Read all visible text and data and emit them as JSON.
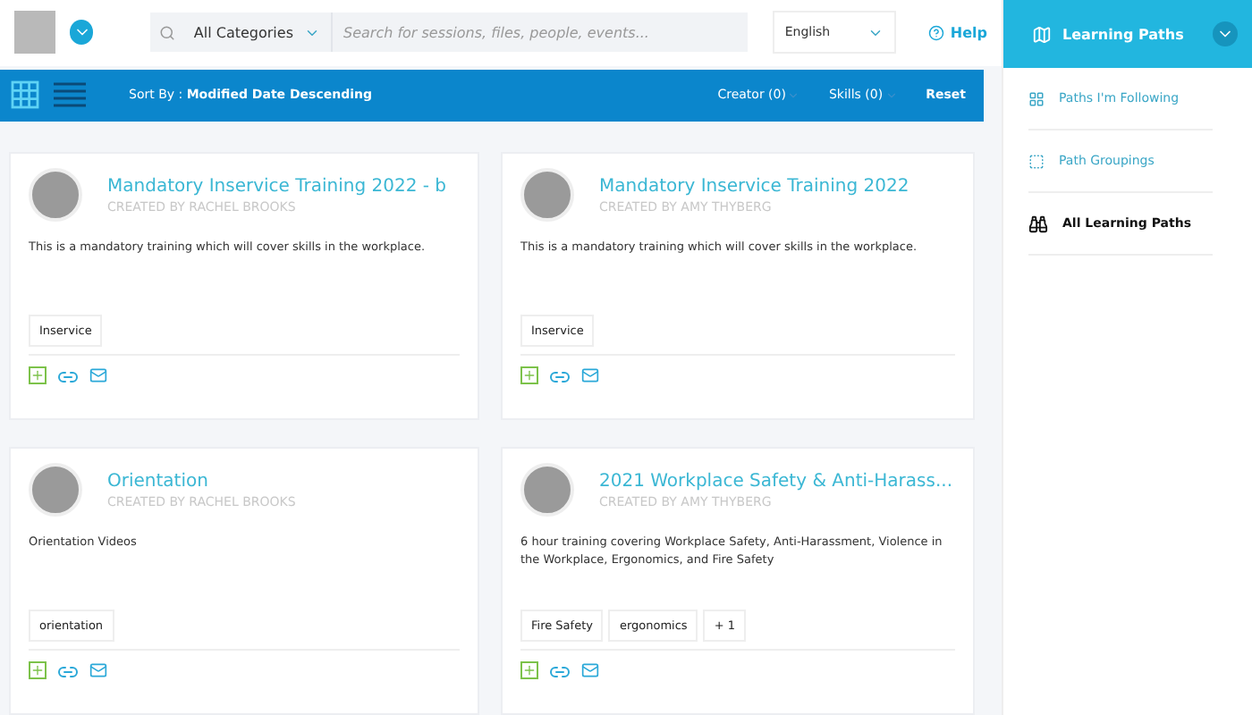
{
  "header": {
    "category": "All Categories",
    "search_placeholder": "Search for sessions, files, people, events...",
    "language": "English",
    "help": "Help"
  },
  "toolbar": {
    "views": [
      {
        "kind": "grid",
        "selected": true
      },
      {
        "kind": "list",
        "selected": false
      }
    ],
    "sort_label": "Sort By :",
    "sort_value": "Modified Date Descending",
    "filters": [
      "Creator (0)",
      "Skills (0)"
    ],
    "reset": "Reset"
  },
  "cards": [
    {
      "title": "Mandatory Inservice Training 2022 - b",
      "creator": "CREATED BY RACHEL BROOKS",
      "description": "This is a mandatory training which will cover skills in the workplace.",
      "tags": [
        "Inservice"
      ]
    },
    {
      "title": "Mandatory Inservice Training 2022",
      "creator": "CREATED BY AMY THYBERG",
      "description": "This is a mandatory training which will cover skills in the workplace.",
      "tags": [
        "Inservice"
      ]
    },
    {
      "title": "Orientation",
      "creator": "CREATED BY RACHEL BROOKS",
      "description": "Orientation Videos",
      "tags": [
        "orientation"
      ]
    },
    {
      "title": "2021 Workplace Safety & Anti-Harass...",
      "creator": "CREATED BY AMY THYBERG",
      "description": "6 hour training covering Workplace Safety, Anti-Harassment, Violence in the Workplace, Ergonomics, and Fire Safety",
      "tags": [
        "Fire Safety",
        "ergonomics",
        "+ 1"
      ]
    }
  ],
  "sidebar": {
    "title": "Learning Paths",
    "items": [
      {
        "kind": "following",
        "label": "Paths I'm Following",
        "selected": false
      },
      {
        "kind": "groupings",
        "label": "Path Groupings",
        "selected": false
      },
      {
        "kind": "all",
        "label": "All Learning Paths",
        "selected": true
      }
    ]
  }
}
